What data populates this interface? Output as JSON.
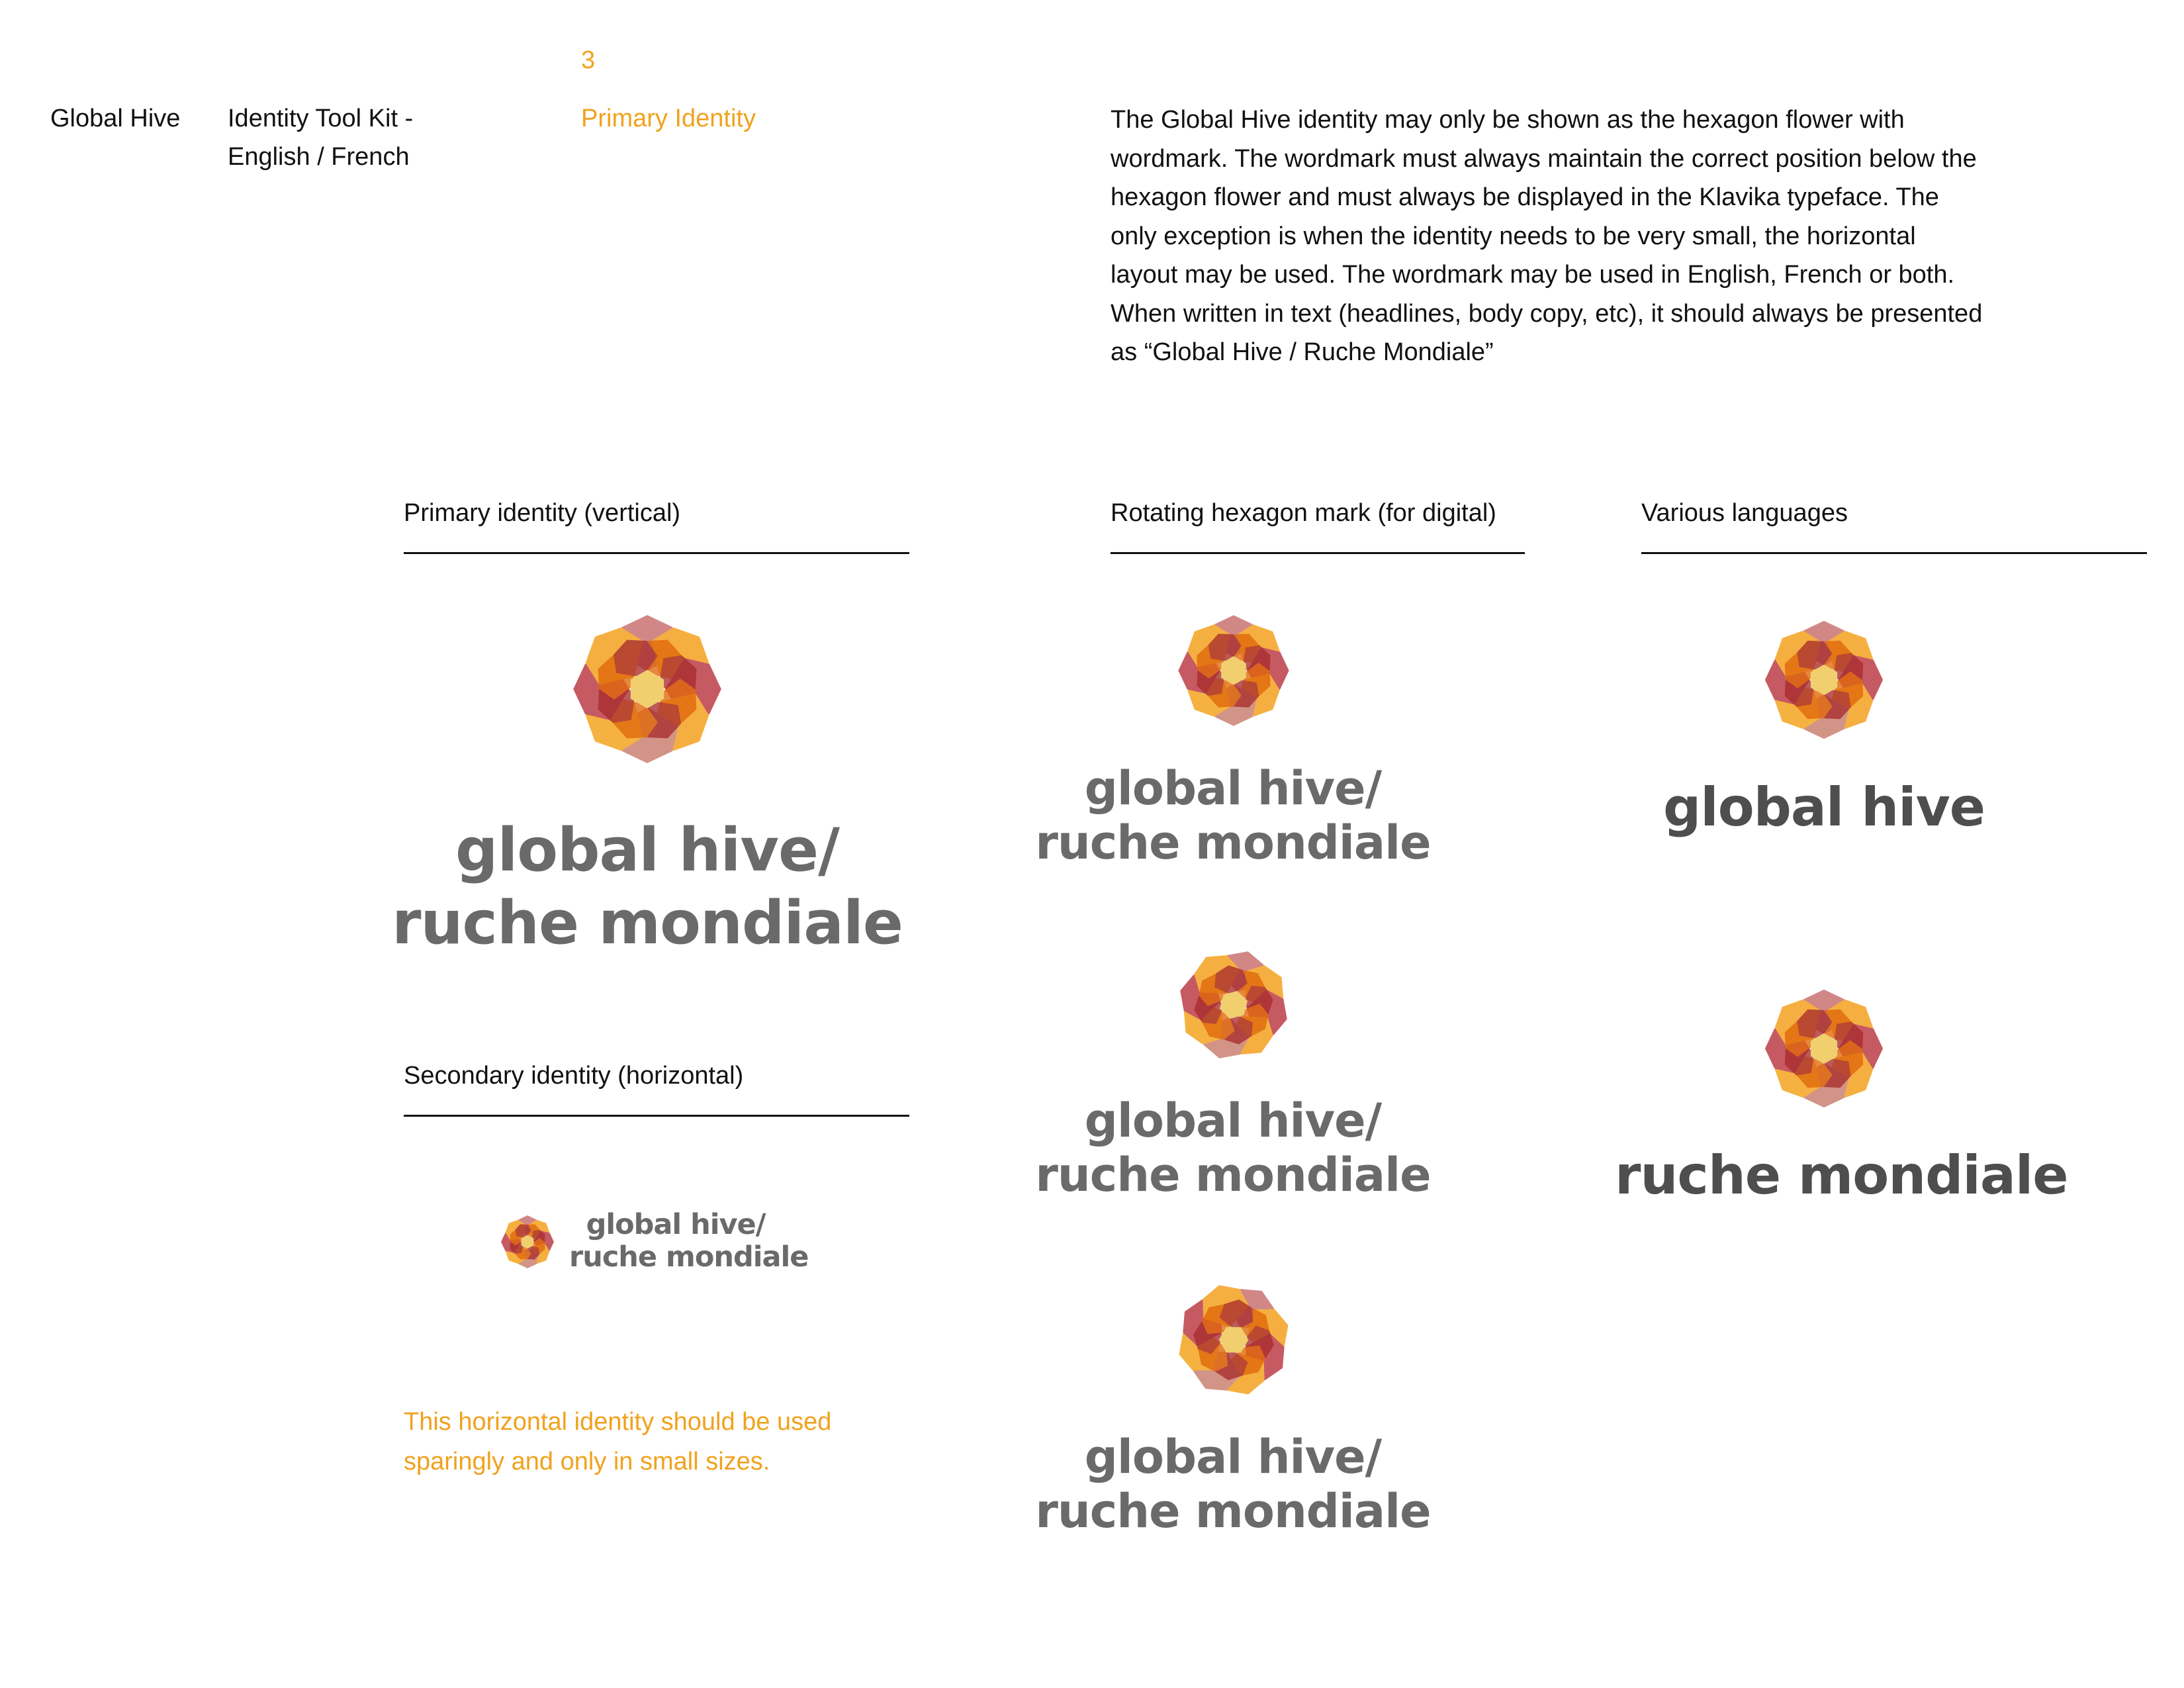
{
  "header": {
    "brand": "Global Hive",
    "kit_line1": "Identity Tool Kit -",
    "kit_line2": "English / French",
    "page_number": "3",
    "section_name": "Primary Identity"
  },
  "intro": "The Global Hive identity may only be shown as the hexagon flower with wordmark. The wordmark must always maintain the correct position below the hexagon flower and must always be displayed in the Klavika typeface. The only exception is when the identity needs to be very small, the horizontal layout may be used. The wordmark may be used in English, French or both. When written in text (headlines, body copy, etc), it should always be presented as “Global Hive / Ruche Mondiale”",
  "sections": {
    "primary": "Primary identity (vertical)",
    "rotating": "Rotating hexagon mark (for digital)",
    "languages": "Various languages",
    "secondary": "Secondary identity (horizontal)"
  },
  "wordmark": {
    "line1": "global hive/",
    "line2": "ruche mondiale",
    "english": "global hive",
    "french": "ruche mondiale"
  },
  "secondary_note": {
    "line1": "This horizontal identity should be used",
    "line2": "sparingly and only in small sizes."
  },
  "colors": {
    "accent_orange": "#f0a21e",
    "petal_dark_orange": "#e0670a",
    "petal_red": "#b8323c",
    "petal_rose": "#c77a6a",
    "center_yellow": "#f2cf6e",
    "wordmark_gray": "#6a6a6a"
  },
  "icons": [
    "hexagon-flower-icon"
  ]
}
